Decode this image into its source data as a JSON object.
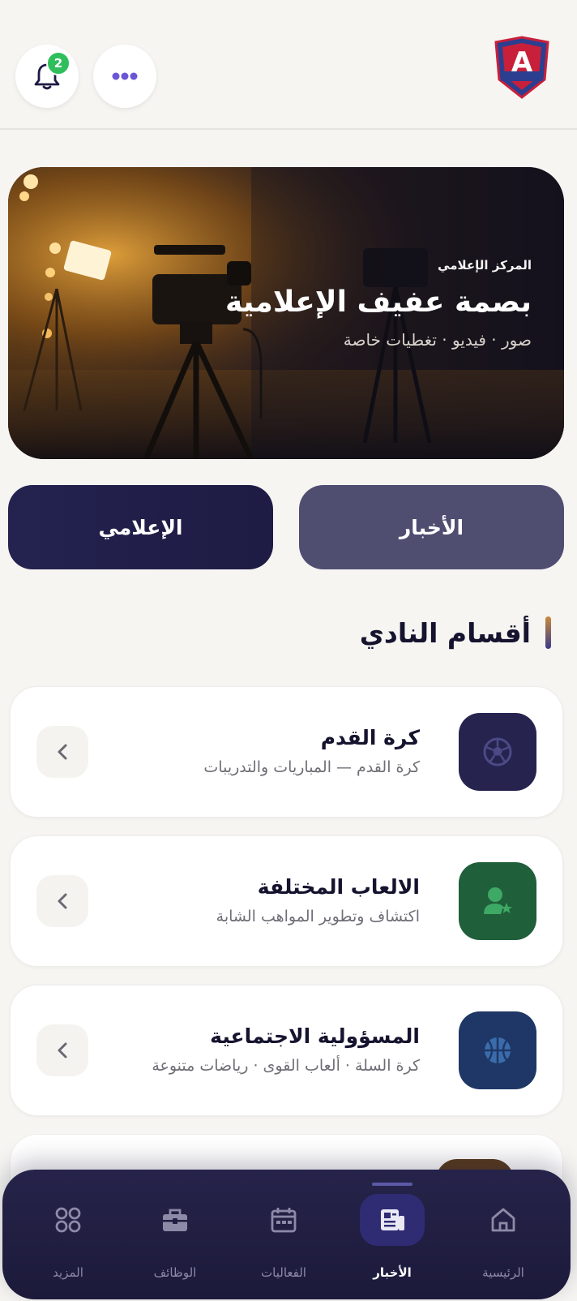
{
  "header": {
    "logo_alt": "شعار نادي عفيف",
    "notifications_count": "2",
    "more_label": "المزيد"
  },
  "hero": {
    "kicker": "المركز الإعلامي",
    "title": "بصمة عفيف الإعلامية",
    "subtitle": "صور · فيديو · تغطيات خاصة"
  },
  "segments": {
    "news_label": "الأخبار",
    "media_label": "الإعلامي"
  },
  "section": {
    "title": "أقسام النادي"
  },
  "cards": [
    {
      "title": "كرة القدم",
      "subtitle": "كرة القدم — المباريات والتدريبات",
      "icon": "soccer-ball-icon",
      "color": "#26244f"
    },
    {
      "title": "الالعاب المختلفة",
      "subtitle": "اكتشاف وتطوير المواهب الشابة",
      "icon": "user-star-icon",
      "color": "#1f5f3a"
    },
    {
      "title": "المسؤولية الاجتماعية",
      "subtitle": "كرة السلة · ألعاب القوى · رياضات متنوعة",
      "icon": "basketball-icon",
      "color": "#1e3766"
    }
  ],
  "nav": {
    "home": "الرئيسية",
    "news": "الأخبار",
    "events": "الفعاليات",
    "jobs": "الوظائف",
    "more": "المزيد",
    "active": "news"
  },
  "colors": {
    "primary": "#24224f",
    "secondary": "#4f4d70",
    "badge": "#2fbe5c",
    "background": "#f6f5f2"
  }
}
